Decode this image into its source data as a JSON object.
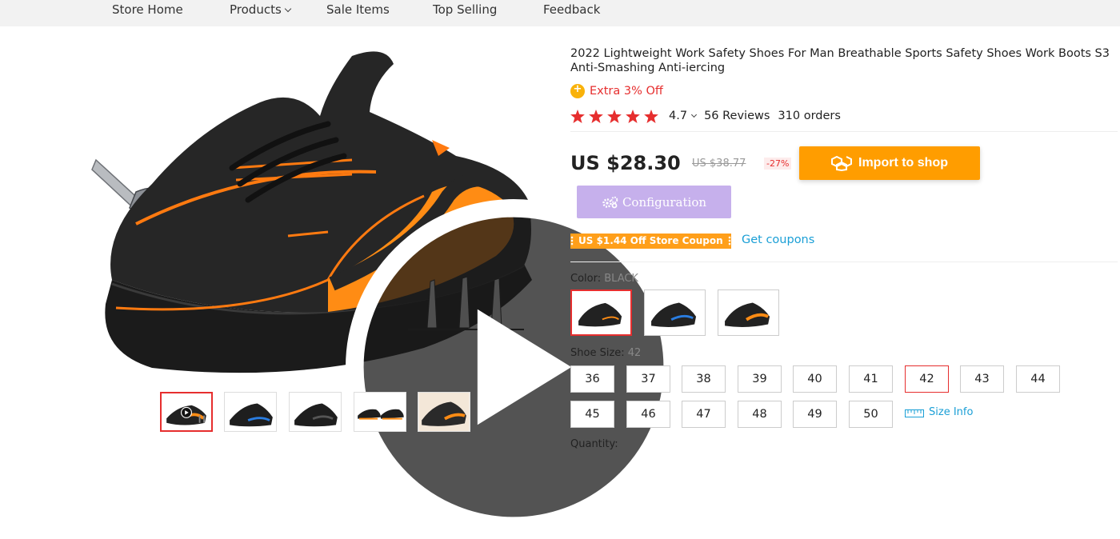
{
  "nav": {
    "items": [
      {
        "label": "Store Home"
      },
      {
        "label": "Products"
      },
      {
        "label": "Sale Items"
      },
      {
        "label": "Top Selling"
      },
      {
        "label": "Feedback"
      }
    ]
  },
  "gallery": {
    "thumb_count": 5,
    "active_thumb": 1
  },
  "product": {
    "title": "2022 Lightweight Work Safety Shoes For Man Breathable Sports Safety Shoes Work Boots S3 Anti-Smashing Anti-iercing",
    "promo": "Extra 3% Off",
    "rating_value": "4.7",
    "rating_stars": 5,
    "reviews": "56 Reviews",
    "orders": "310 orders",
    "price": "US $28.30",
    "old_price": "US $38.77",
    "discount": "-27%"
  },
  "actions": {
    "import_label": "Import to shop",
    "config_label": "Configuration"
  },
  "coupon": {
    "label": "US $1.44 Off Store Coupon",
    "link": "Get coupons"
  },
  "color": {
    "label": "Color:",
    "value": "BLACK",
    "swatches": [
      {
        "name": "black-orange",
        "selected": true
      },
      {
        "name": "black-blue",
        "selected": false
      },
      {
        "name": "black-orange-2",
        "selected": false
      }
    ]
  },
  "size": {
    "label": "Shoe Size:",
    "value": "42",
    "options": [
      "36",
      "37",
      "38",
      "39",
      "40",
      "41",
      "42",
      "43",
      "44",
      "45",
      "46",
      "47",
      "48",
      "49",
      "50"
    ],
    "selected": "42",
    "size_info": "Size Info"
  },
  "quantity": {
    "label": "Quantity:"
  },
  "colors": {
    "accent_red": "#e62e2e",
    "import_orange": "#ff9d00",
    "config_purple": "#c6b0ec",
    "link_blue": "#1a9fd6",
    "coupon_orange": "#ff9f1a"
  }
}
